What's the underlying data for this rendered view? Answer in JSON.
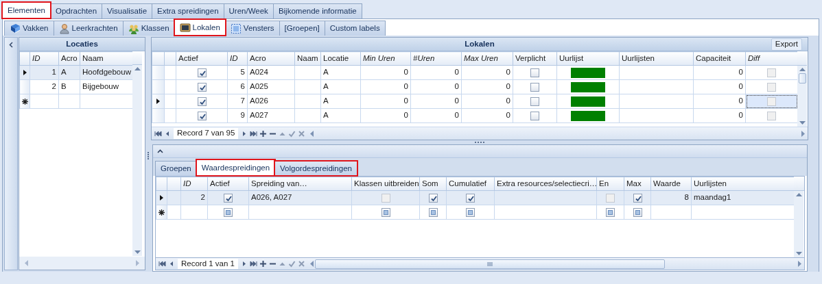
{
  "main_tabs": [
    {
      "label": "Elementen",
      "selected": true,
      "highlighted": true
    },
    {
      "label": "Opdrachten",
      "selected": false,
      "highlighted": false
    },
    {
      "label": "Visualisatie",
      "selected": false,
      "highlighted": false
    },
    {
      "label": "Extra spreidingen",
      "selected": false,
      "highlighted": false
    },
    {
      "label": "Uren/Week",
      "selected": false,
      "highlighted": false
    },
    {
      "label": "Bijkomende informatie",
      "selected": false,
      "highlighted": false
    }
  ],
  "sub_tabs": [
    {
      "label": "Vakken",
      "selected": false,
      "highlighted": false
    },
    {
      "label": "Leerkrachten",
      "selected": false,
      "highlighted": false
    },
    {
      "label": "Klassen",
      "selected": false,
      "highlighted": false
    },
    {
      "label": "Lokalen",
      "selected": true,
      "highlighted": true
    },
    {
      "label": "Vensters",
      "selected": false,
      "highlighted": false
    },
    {
      "label": "[Groepen]",
      "selected": false,
      "highlighted": false
    },
    {
      "label": "Custom labels",
      "selected": false,
      "highlighted": false
    }
  ],
  "locaties": {
    "title": "Locaties",
    "has_focus": false,
    "columns": [
      {
        "label": "ID",
        "kind": "num",
        "italic": true
      },
      {
        "label": "Acro",
        "kind": "text",
        "italic": false
      },
      {
        "label": "Naam",
        "kind": "text",
        "italic": false
      }
    ],
    "rows": [
      {
        "current": true,
        "new": false,
        "cells": [
          "1",
          "A",
          "Hoofdgebouw"
        ]
      },
      {
        "current": false,
        "new": false,
        "cells": [
          "2",
          "B",
          "Bijgebouw"
        ]
      },
      {
        "current": false,
        "new": true,
        "cells": [
          null,
          null,
          null
        ]
      }
    ]
  },
  "lokalen": {
    "title": "Lokalen",
    "button": "Export",
    "has_focus": true,
    "navigator": "Record 7 van 95",
    "columns": [
      {
        "label": "Actief",
        "kind": "check",
        "italic": false,
        "disabled": false,
        "focused": false
      },
      {
        "label": "ID",
        "kind": "num",
        "italic": true,
        "focused": false
      },
      {
        "label": "Acro",
        "kind": "text",
        "italic": false,
        "focused": false
      },
      {
        "label": "Naam",
        "kind": "text",
        "italic": false,
        "focused": false
      },
      {
        "label": "Locatie",
        "kind": "text",
        "italic": false,
        "focused": false
      },
      {
        "label": "Min Uren",
        "kind": "num",
        "italic": true,
        "focused": false
      },
      {
        "label": "#Uren",
        "kind": "num",
        "italic": true,
        "focused": false
      },
      {
        "label": "Max Uren",
        "kind": "num",
        "italic": true,
        "focused": false
      },
      {
        "label": "Verplicht",
        "kind": "check",
        "italic": false,
        "disabled": false,
        "focused": false
      },
      {
        "label": "Uurlijst",
        "kind": "color",
        "italic": false,
        "focused": false
      },
      {
        "label": "Uurlijsten",
        "kind": "text",
        "italic": false,
        "focused": false
      },
      {
        "label": "Capaciteit",
        "kind": "num",
        "italic": false,
        "focused": false
      },
      {
        "label": "Diff",
        "kind": "check",
        "italic": true,
        "disabled": true,
        "focused": true
      }
    ],
    "rows": [
      {
        "current": false,
        "new": false,
        "color": "#008000",
        "cells": [
          true,
          "5",
          "A024",
          null,
          "A",
          "0",
          "0",
          "0",
          false,
          null,
          null,
          "0",
          false
        ]
      },
      {
        "current": false,
        "new": false,
        "color": "#008000",
        "cells": [
          true,
          "6",
          "A025",
          null,
          "A",
          "0",
          "0",
          "0",
          false,
          null,
          null,
          "0",
          false
        ]
      },
      {
        "current": true,
        "new": false,
        "color": "#008000",
        "cells": [
          true,
          "7",
          "A026",
          null,
          "A",
          "0",
          "0",
          "0",
          false,
          null,
          null,
          "0",
          false
        ]
      },
      {
        "current": false,
        "new": false,
        "color": "#008000",
        "cells": [
          true,
          "9",
          "A027",
          null,
          "A",
          "0",
          "0",
          "0",
          false,
          null,
          null,
          "0",
          false
        ]
      }
    ]
  },
  "detail": {
    "tabs": [
      {
        "label": "Groepen",
        "selected": false,
        "highlighted": false
      },
      {
        "label": "Waardespreidingen",
        "selected": true,
        "highlighted": true
      },
      {
        "label": "Volgordespreidingen",
        "selected": false,
        "highlighted": true
      }
    ],
    "grid": {
      "has_focus": false,
      "navigator": "Record 1 van 1",
      "columns": [
        {
          "label": "ID",
          "kind": "num",
          "italic": true
        },
        {
          "label": "Actief",
          "kind": "check",
          "italic": false,
          "disabled": false
        },
        {
          "label": "Spreiding van…",
          "kind": "text",
          "italic": false
        },
        {
          "label": "Klassen uitbreiden",
          "kind": "check",
          "italic": false,
          "disabled": true
        },
        {
          "label": "Som",
          "kind": "check",
          "italic": false,
          "disabled": false
        },
        {
          "label": "Cumulatief",
          "kind": "check",
          "italic": false,
          "disabled": false
        },
        {
          "label": "Extra resources/selectiecri…",
          "kind": "text",
          "italic": false
        },
        {
          "label": "En",
          "kind": "check",
          "italic": false,
          "disabled": true
        },
        {
          "label": "Max",
          "kind": "check",
          "italic": false,
          "disabled": false
        },
        {
          "label": "Waarde",
          "kind": "num",
          "italic": false
        },
        {
          "label": "Uurlijsten",
          "kind": "text",
          "italic": false
        }
      ],
      "rows": [
        {
          "current": true,
          "new": false,
          "cells": [
            "2",
            true,
            "A026, A027",
            false,
            true,
            true,
            null,
            false,
            true,
            "8",
            "maandag1"
          ]
        },
        {
          "current": false,
          "new": true,
          "cells": [
            null,
            null,
            null,
            null,
            null,
            null,
            null,
            null,
            null,
            null,
            null
          ]
        }
      ]
    }
  }
}
